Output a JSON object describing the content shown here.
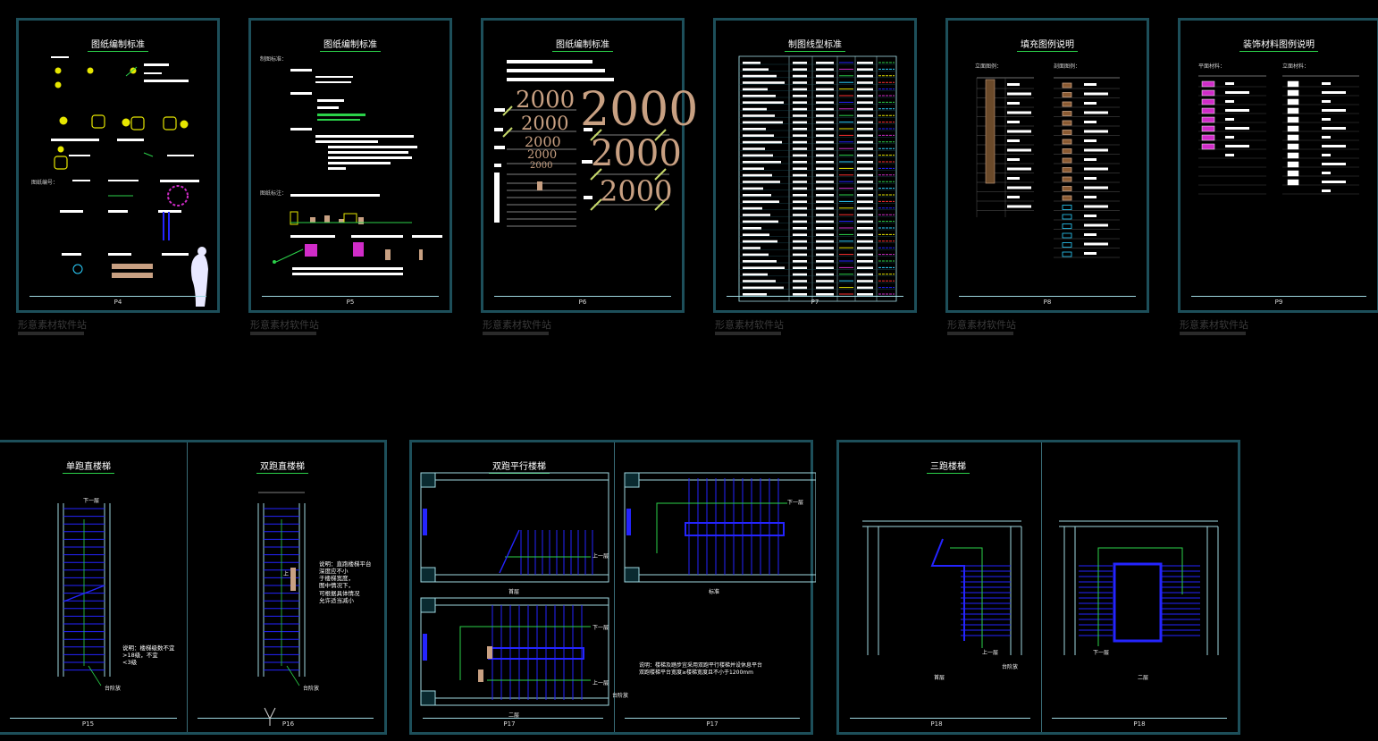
{
  "top_sheets": [
    {
      "title": "图纸编制标准",
      "page": "P4"
    },
    {
      "title": "图纸编制标准",
      "page": "P5"
    },
    {
      "title": "图纸编制标准",
      "page": "P6"
    },
    {
      "title": "制图线型标准",
      "page": "P7"
    },
    {
      "title": "填充图例说明",
      "page": "P8"
    },
    {
      "title": "装饰材料图例说明",
      "page": "P9"
    }
  ],
  "watermark": "形意素材软件站",
  "p5_labels": {
    "a": "制图标准：",
    "b": "图纸标注："
  },
  "p4_label": "图纸编号：",
  "p6_numbers": [
    "2000",
    "2000",
    "2000",
    "2000",
    "2000"
  ],
  "p6_big": [
    "2000",
    "2000",
    "2000"
  ],
  "p8_labels": {
    "left": "立面图例：",
    "right": "剖面图例："
  },
  "p9_labels": {
    "left": "平面材料：",
    "right": "立面材料："
  },
  "bottom_sheets": [
    {
      "title": "单跑直楼梯",
      "page": "P15"
    },
    {
      "title": "双跑直楼梯",
      "page": "P16"
    },
    {
      "title": "双跑平行楼梯",
      "page": "P17"
    },
    {
      "title": "",
      "page": "P17"
    },
    {
      "title": "三跑楼梯",
      "page": "P18"
    },
    {
      "title": "",
      "page": "P18"
    }
  ],
  "stair_labels": {
    "down1": "下一层",
    "note_p15": "说明：楼梯级数不宜\n>18级，不宜\n<3级",
    "step": "台阶放",
    "up": "上",
    "note_p16": "说明：直跑楼梯平台\n深度应不小\n于楼梯宽度，\n图中情况下，\n可根据具体情况\n允许适当减小",
    "down2": "下一层",
    "up1": "上一层",
    "fl1": "首层",
    "fl2": "二层",
    "fl_std": "标准",
    "note_p17": "说明：楼梯及踏步宜采用双跑平行楼梯并设休息平台\n双跑楼梯平台宽度≥楼梯宽度且不小于1200mm"
  }
}
